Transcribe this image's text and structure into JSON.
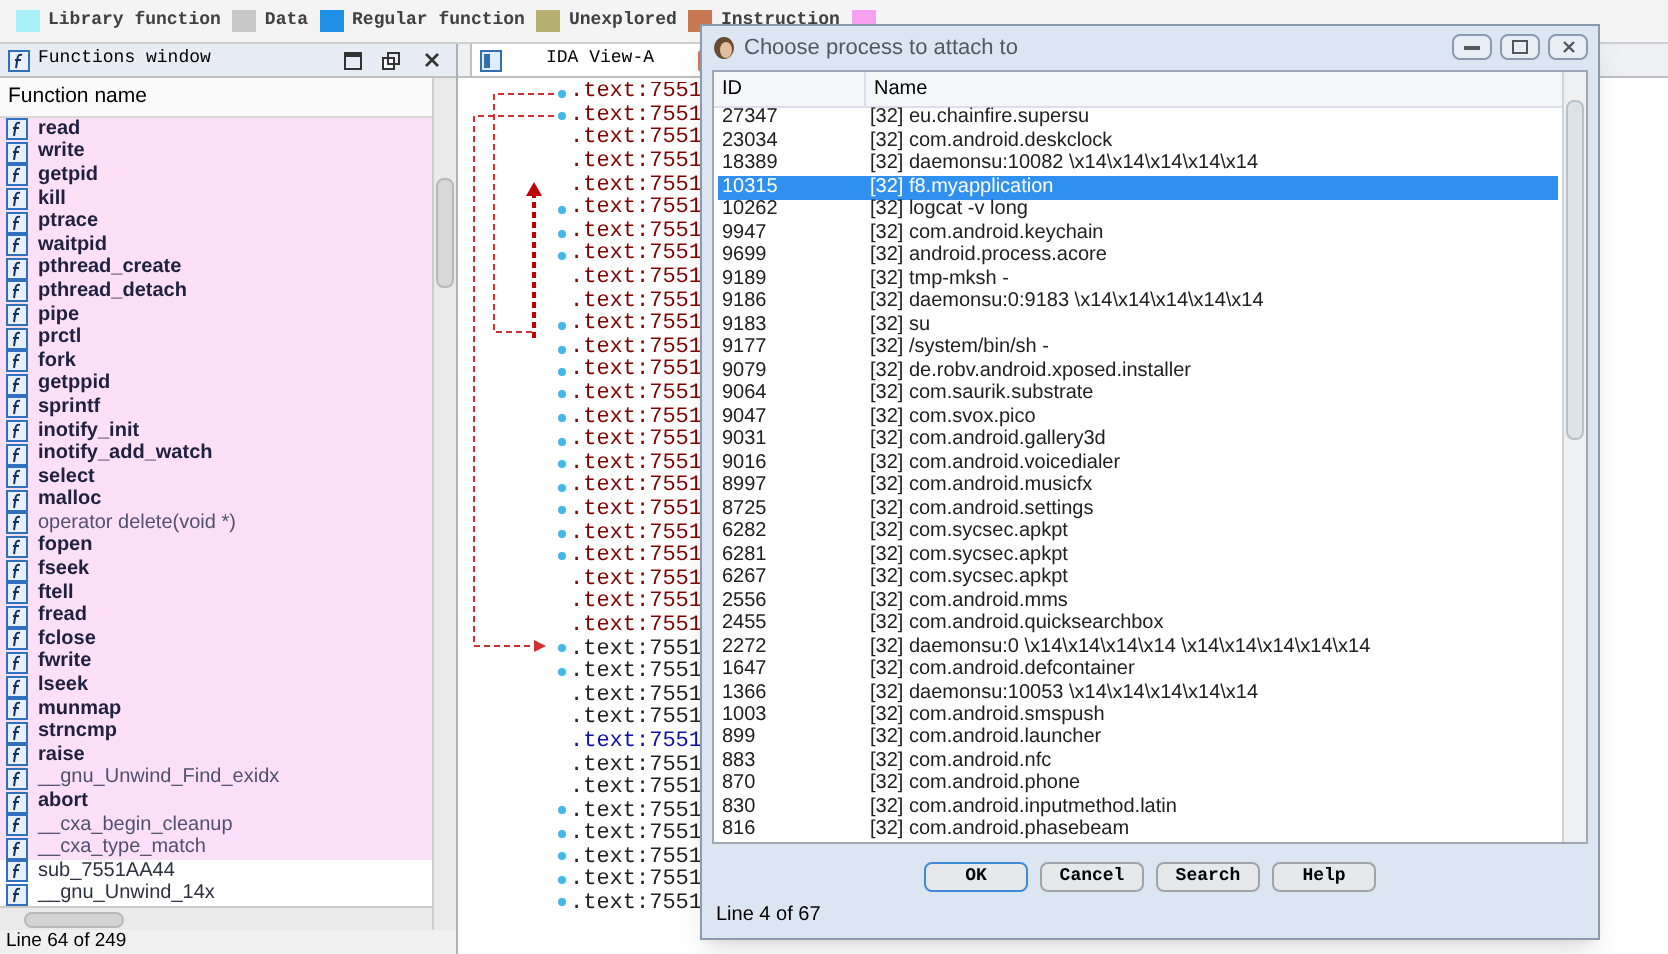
{
  "legend": [
    {
      "label": "Library function",
      "color": "#a8f0f8"
    },
    {
      "label": "Data",
      "color": "#c8c8c8"
    },
    {
      "label": "Regular function",
      "color": "#1e90e8"
    },
    {
      "label": "Unexplored",
      "color": "#b8b070"
    },
    {
      "label": "Instruction",
      "color": "#c87850"
    },
    {
      "color": "#f8a0f0"
    }
  ],
  "functions_window": {
    "title": "Functions window",
    "column": "Function name",
    "items": [
      {
        "name": "read",
        "kind": "bold"
      },
      {
        "name": "write",
        "kind": "bold"
      },
      {
        "name": "getpid",
        "kind": "bold"
      },
      {
        "name": "kill",
        "kind": "bold"
      },
      {
        "name": "ptrace",
        "kind": "bold"
      },
      {
        "name": "waitpid",
        "kind": "bold"
      },
      {
        "name": "pthread_create",
        "kind": "bold"
      },
      {
        "name": "pthread_detach",
        "kind": "bold"
      },
      {
        "name": "pipe",
        "kind": "bold"
      },
      {
        "name": "prctl",
        "kind": "bold"
      },
      {
        "name": "fork",
        "kind": "bold"
      },
      {
        "name": "getppid",
        "kind": "bold"
      },
      {
        "name": "sprintf",
        "kind": "bold"
      },
      {
        "name": "inotify_init",
        "kind": "bold"
      },
      {
        "name": "inotify_add_watch",
        "kind": "bold"
      },
      {
        "name": "select",
        "kind": "bold"
      },
      {
        "name": "malloc",
        "kind": "bold"
      },
      {
        "name": "operator delete(void *)",
        "kind": "library"
      },
      {
        "name": "fopen",
        "kind": "bold"
      },
      {
        "name": "fseek",
        "kind": "bold"
      },
      {
        "name": "ftell",
        "kind": "bold"
      },
      {
        "name": "fread",
        "kind": "bold"
      },
      {
        "name": "fclose",
        "kind": "bold"
      },
      {
        "name": "fwrite",
        "kind": "bold"
      },
      {
        "name": "lseek",
        "kind": "bold"
      },
      {
        "name": "munmap",
        "kind": "bold"
      },
      {
        "name": "strncmp",
        "kind": "bold"
      },
      {
        "name": "raise",
        "kind": "bold"
      },
      {
        "name": "__gnu_Unwind_Find_exidx",
        "kind": "library"
      },
      {
        "name": "abort",
        "kind": "bold"
      },
      {
        "name": "__cxa_begin_cleanup",
        "kind": "library"
      },
      {
        "name": "__cxa_type_match",
        "kind": "library"
      },
      {
        "name": "sub_7551AA44",
        "kind": "regular"
      },
      {
        "name": "__gnu_Unwind_14x",
        "kind": "regular"
      }
    ],
    "status": "Line 64 of 249"
  },
  "ida_view": {
    "tab": "IDA View-A",
    "lines": [
      {
        "text": ".text:7551",
        "color": "#800000"
      },
      {
        "text": ".text:7551",
        "color": "#800000"
      },
      {
        "text": ".text:7551",
        "color": "#800000"
      },
      {
        "text": ".text:7551",
        "color": "#800000"
      },
      {
        "text": ".text:7551",
        "color": "#800000"
      },
      {
        "text": ".text:7551",
        "color": "#800000"
      },
      {
        "text": ".text:7551",
        "color": "#800000"
      },
      {
        "text": ".text:7551",
        "color": "#800000"
      },
      {
        "text": ".text:7551",
        "color": "#800000"
      },
      {
        "text": ".text:7551",
        "color": "#800000"
      },
      {
        "text": ".text:7551",
        "color": "#800000"
      },
      {
        "text": ".text:7551",
        "color": "#800000"
      },
      {
        "text": ".text:7551",
        "color": "#800000"
      },
      {
        "text": ".text:7551",
        "color": "#800000"
      },
      {
        "text": ".text:7551",
        "color": "#800000"
      },
      {
        "text": ".text:7551",
        "color": "#800000"
      },
      {
        "text": ".text:7551",
        "color": "#800000"
      },
      {
        "text": ".text:7551",
        "color": "#800000"
      },
      {
        "text": ".text:7551",
        "color": "#800000"
      },
      {
        "text": ".text:7551",
        "color": "#800000"
      },
      {
        "text": ".text:7551",
        "color": "#800000"
      },
      {
        "text": ".text:7551",
        "color": "#800000"
      },
      {
        "text": ".text:7551",
        "color": "#800000"
      },
      {
        "text": ".text:7551",
        "color": "#800000"
      },
      {
        "text": ".text:7551",
        "color": "#202020"
      },
      {
        "text": ".text:7551",
        "color": "#202020"
      },
      {
        "text": ".text:7551",
        "color": "#202020"
      },
      {
        "text": ".text:7551",
        "color": "#202020"
      },
      {
        "text": ".text:7551",
        "color": "#1010a0"
      },
      {
        "text": ".text:7551",
        "color": "#202020"
      },
      {
        "text": ".text:7551",
        "color": "#202020"
      },
      {
        "text": ".text:7551",
        "color": "#202020"
      },
      {
        "text": ".text:7551",
        "color": "#202020"
      },
      {
        "text": ".text:7551",
        "color": "#202020"
      },
      {
        "text": ".text:7551",
        "color": "#202020"
      },
      {
        "text": ".text:7551",
        "color": "#202020"
      }
    ]
  },
  "dialog": {
    "title": "Choose process to attach to",
    "columns": [
      "ID",
      "Name"
    ],
    "rows": [
      {
        "id": "27347",
        "name": "[32] eu.chainfire.supersu",
        "selected": false
      },
      {
        "id": "23034",
        "name": "[32] com.android.deskclock",
        "selected": false
      },
      {
        "id": "18389",
        "name": "[32] daemonsu:10082  \\x14\\x14\\x14\\x14\\x14",
        "selected": false
      },
      {
        "id": "10315",
        "name": "[32] f8.myapplication",
        "selected": true
      },
      {
        "id": "10262",
        "name": "[32] logcat -v long",
        "selected": false
      },
      {
        "id": "9947",
        "name": "[32] com.android.keychain",
        "selected": false
      },
      {
        "id": "9699",
        "name": "[32] android.process.acore",
        "selected": false
      },
      {
        "id": "9189",
        "name": "[32] tmp-mksh -",
        "selected": false
      },
      {
        "id": "9186",
        "name": "[32] daemonsu:0:9183 \\x14\\x14\\x14\\x14\\x14",
        "selected": false
      },
      {
        "id": "9183",
        "name": "[32] su",
        "selected": false
      },
      {
        "id": "9177",
        "name": "[32] /system/bin/sh -",
        "selected": false
      },
      {
        "id": "9079",
        "name": "[32] de.robv.android.xposed.installer",
        "selected": false
      },
      {
        "id": "9064",
        "name": "[32] com.saurik.substrate",
        "selected": false
      },
      {
        "id": "9047",
        "name": "[32] com.svox.pico",
        "selected": false
      },
      {
        "id": "9031",
        "name": "[32] com.android.gallery3d",
        "selected": false
      },
      {
        "id": "9016",
        "name": "[32] com.android.voicedialer",
        "selected": false
      },
      {
        "id": "8997",
        "name": "[32] com.android.musicfx",
        "selected": false
      },
      {
        "id": "8725",
        "name": "[32] com.android.settings",
        "selected": false
      },
      {
        "id": "6282",
        "name": "[32] com.sycsec.apkpt",
        "selected": false
      },
      {
        "id": "6281",
        "name": "[32] com.sycsec.apkpt",
        "selected": false
      },
      {
        "id": "6267",
        "name": "[32] com.sycsec.apkpt",
        "selected": false
      },
      {
        "id": "2556",
        "name": "[32] com.android.mms",
        "selected": false
      },
      {
        "id": "2455",
        "name": "[32] com.android.quicksearchbox",
        "selected": false
      },
      {
        "id": "2272",
        "name": "[32] daemonsu:0 \\x14\\x14\\x14\\x14 \\x14\\x14\\x14\\x14\\x14",
        "selected": false
      },
      {
        "id": "1647",
        "name": "[32] com.android.defcontainer",
        "selected": false
      },
      {
        "id": "1366",
        "name": "[32] daemonsu:10053  \\x14\\x14\\x14\\x14\\x14",
        "selected": false
      },
      {
        "id": "1003",
        "name": "[32] com.android.smspush",
        "selected": false
      },
      {
        "id": "899",
        "name": "[32] com.android.launcher",
        "selected": false
      },
      {
        "id": "883",
        "name": "[32] com.android.nfc",
        "selected": false
      },
      {
        "id": "870",
        "name": "[32] com.android.phone",
        "selected": false
      },
      {
        "id": "830",
        "name": "[32] com.android.inputmethod.latin",
        "selected": false
      },
      {
        "id": "816",
        "name": "[32] com.android.phasebeam",
        "selected": false
      }
    ],
    "buttons": [
      "OK",
      "Cancel",
      "Search",
      "Help"
    ],
    "status": "Line 4 of 67"
  }
}
